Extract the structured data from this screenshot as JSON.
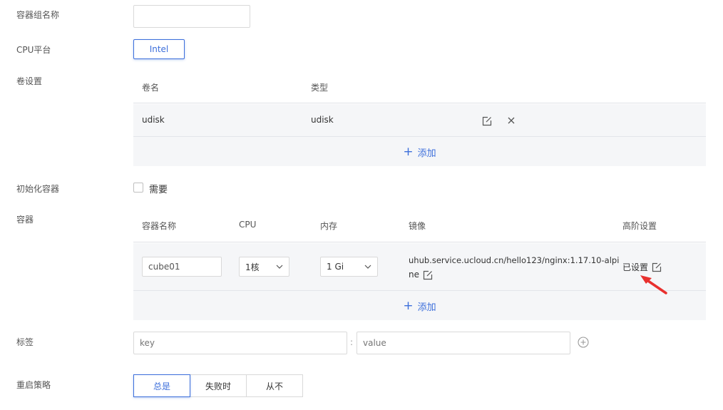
{
  "form": {
    "group_name_label": "容器组名称",
    "cpu_platform_label": "CPU平台",
    "cpu_platform_option": "Intel",
    "volume_label": "卷设置",
    "init_container_label": "初始化容器",
    "init_container_checkbox": "需要",
    "container_label": "容器",
    "tag_label": "标签",
    "restart_label": "重启策略"
  },
  "volumes": {
    "col_name": "卷名",
    "col_type": "类型",
    "rows": [
      {
        "name": "udisk",
        "type": "udisk"
      }
    ],
    "add_label": "添加"
  },
  "containers": {
    "col_name": "容器名称",
    "col_cpu": "CPU",
    "col_memory": "内存",
    "col_image": "镜像",
    "col_advanced": "高阶设置",
    "rows": [
      {
        "name": "cube01",
        "cpu": "1核",
        "memory": "1 Gi",
        "image_line1": "uhub.service.ucloud.cn/hello123/nginx:1.17.10-alpi",
        "image_line2": "ne",
        "advanced": "已设置"
      }
    ],
    "add_label": "添加"
  },
  "tags": {
    "key_placeholder": "key",
    "separator": ":",
    "value_placeholder": "value"
  },
  "restart_policy": {
    "options": [
      "总是",
      "失败时",
      "从不"
    ],
    "selected": "总是"
  },
  "colors": {
    "accent": "#3d6fdb",
    "arrow": "#e8302e",
    "panel": "#f5f6f8"
  },
  "icons": [
    "edit-icon",
    "close-icon",
    "chevron-down-icon",
    "plus-icon",
    "add-circle-icon",
    "arrow-annotation"
  ]
}
